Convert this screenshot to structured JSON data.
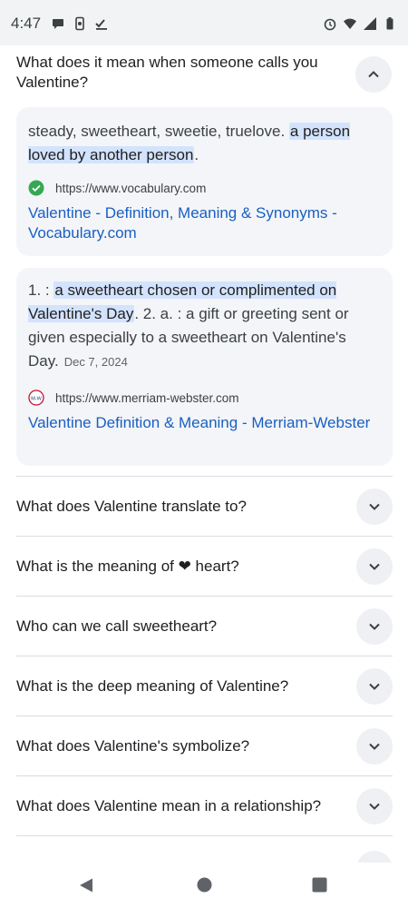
{
  "status": {
    "time": "4:47"
  },
  "expanded_question": "What does it mean when someone calls you Valentine?",
  "results": [
    {
      "snippet_plain": "steady, sweetheart, sweetie, truelove.",
      "snippet_highlight": "a person loved by another person",
      "snippet_tail": ".",
      "url": "https://www.vocabulary.com",
      "link_title": "Valentine - Definition, Meaning & Synonyms - Vocabulary.com"
    },
    {
      "snippet_lead": "1. :",
      "snippet_highlight": "a sweetheart chosen or complimented on Valentine's Day",
      "snippet_rest": ". 2. a. : a gift or greeting sent or given especially to a sweetheart on Valentine's Day.",
      "date": "Dec 7, 2024",
      "url": "https://www.merriam-webster.com",
      "link_title": "Valentine Definition & Meaning - Merriam-Webster",
      "favicon_text": "M-W"
    }
  ],
  "more_questions": [
    "What does Valentine translate to?",
    "What is the meaning of ❤ heart?",
    "Who can we call sweetheart?",
    "What is the deep meaning of Valentine?",
    "What does Valentine's symbolize?",
    "What does Valentine mean in a relationship?"
  ],
  "icons": {
    "chevron_up": "chevron-up-icon",
    "chevron_down": "chevron-down-icon",
    "verified": "check-circle-icon",
    "nav_back": "back-triangle-icon",
    "nav_home": "home-circle-icon",
    "nav_recents": "recents-square-icon"
  },
  "colors": {
    "link": "#1a5fc3",
    "highlight": "#d3e3fd",
    "card_bg": "#f3f5f8",
    "verified_green": "#34a853"
  }
}
